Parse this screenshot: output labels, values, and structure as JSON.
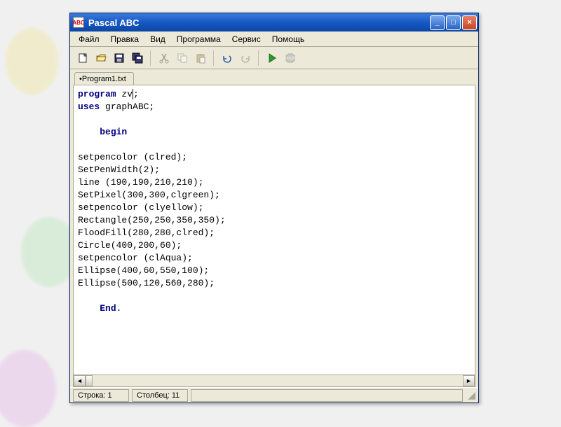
{
  "window": {
    "title": "Pascal ABC",
    "icon_text": "ABC"
  },
  "win_btns": {
    "min": "_",
    "max": "□",
    "close": "×"
  },
  "menu": [
    "Файл",
    "Правка",
    "Вид",
    "Программа",
    "Сервис",
    "Помощь"
  ],
  "tabs": [
    {
      "label": "Program1.txt",
      "modified": true
    }
  ],
  "code": {
    "t_program": "program",
    "t_prog_id": " zv",
    "t_prog_end": ";",
    "t_uses": "uses",
    "t_uses_body": " graphABC;",
    "t_begin": "begin",
    "lines": [
      "setpencolor (clred);",
      "SetPenWidth(2);",
      "line (190,190,210,210);",
      "SetPixel(300,300,clgreen);",
      "setpencolor (clyellow);",
      "Rectangle(250,250,350,350);",
      "FloodFill(280,280,clred);",
      "Circle(400,200,60);",
      "setpencolor (clAqua);",
      "Ellipse(400,60,550,100);",
      "Ellipse(500,120,560,280);"
    ],
    "t_end": "End",
    "t_end_dot": "."
  },
  "status": {
    "line_label": "Строка: 1",
    "col_label": "Столбец: 11"
  },
  "colors": {
    "titlebar": "#1559c4",
    "keyword": "#000080",
    "bg": "#ece9d8"
  }
}
